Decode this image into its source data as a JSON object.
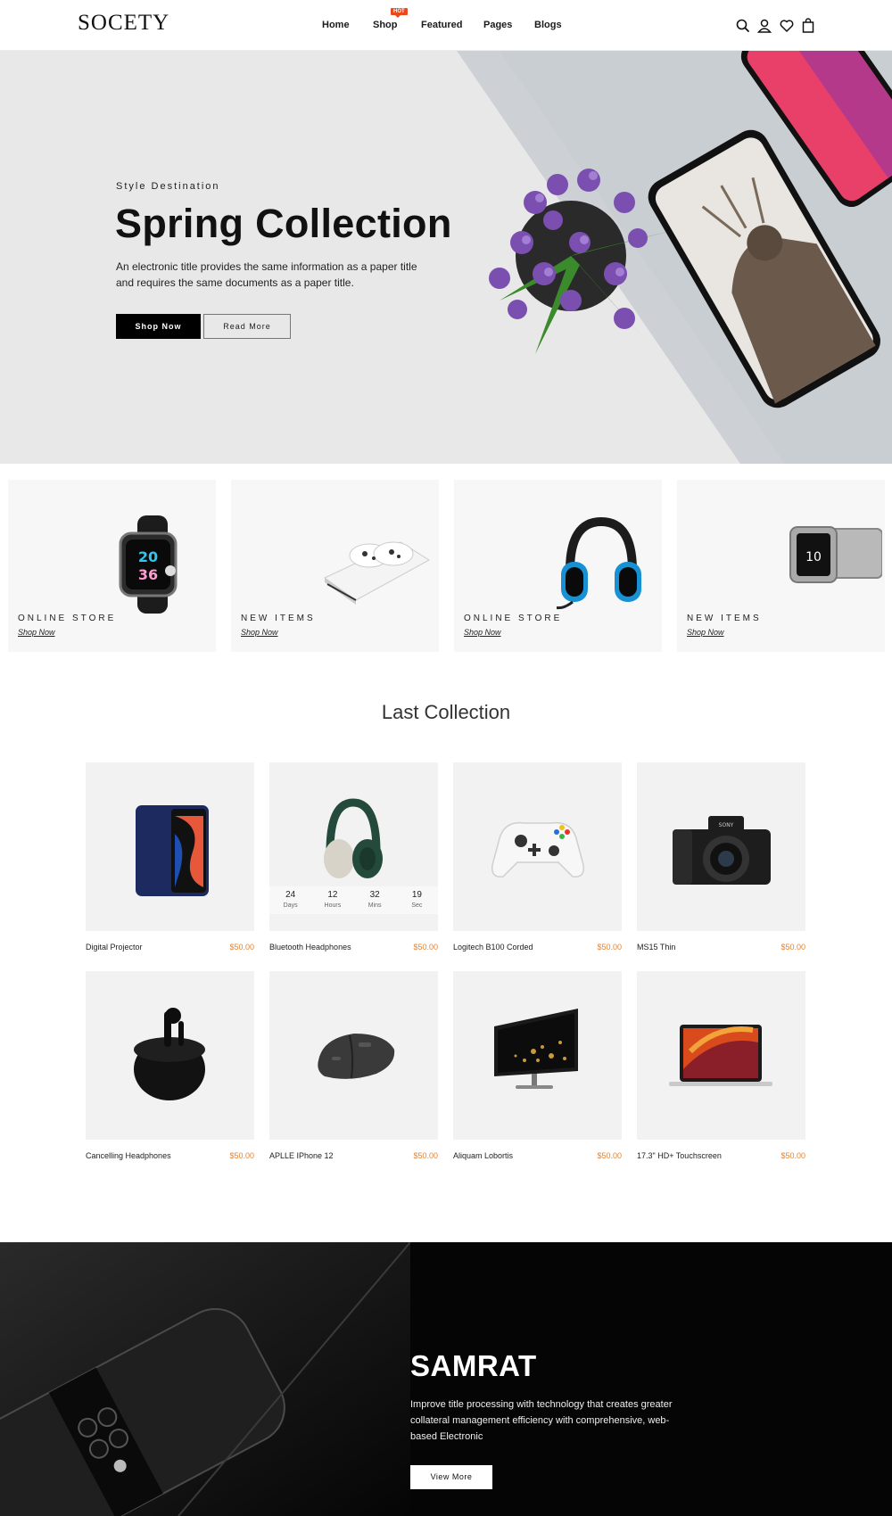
{
  "header": {
    "logo": "SOCETY",
    "nav": [
      {
        "label": "Home"
      },
      {
        "label": "Shop"
      },
      {
        "label": "Featured"
      },
      {
        "label": "Pages"
      },
      {
        "label": "Blogs"
      }
    ],
    "hot_badge": "HOT",
    "icons": [
      "search-icon",
      "user-icon",
      "heart-icon",
      "bag-icon"
    ]
  },
  "hero": {
    "kicker": "Style Destination",
    "title": "Spring Collection",
    "description": "An electronic title provides the same information as a paper title and requires the same documents as a paper title.",
    "primary_button": "Shop Now",
    "secondary_button": "Read More"
  },
  "categories": [
    {
      "label": "ONLINE STORE",
      "link": "Shop Now",
      "product": "smartwatch"
    },
    {
      "label": "NEW ITEMS",
      "link": "Shop Now",
      "product": "game-console"
    },
    {
      "label": "ONLINE STORE",
      "link": "Shop Now",
      "product": "headphones"
    },
    {
      "label": "NEW ITEMS",
      "link": "Shop Now",
      "product": "steel-watch"
    }
  ],
  "collection": {
    "title": "Last Collection",
    "products": [
      {
        "name": "Digital Projector",
        "price": "$50.00",
        "image": "smartphone"
      },
      {
        "name": "Bluetooth Headphones",
        "price": "$50.00",
        "image": "headphones"
      },
      {
        "name": "Logitech B100 Corded",
        "price": "$50.00",
        "image": "game-controller"
      },
      {
        "name": "MS15 Thin",
        "price": "$50.00",
        "image": "camera"
      },
      {
        "name": "Cancelling Headphones",
        "price": "$50.00",
        "image": "earbuds"
      },
      {
        "name": "APLLE IPhone 12",
        "price": "$50.00",
        "image": "mouse"
      },
      {
        "name": "Aliquam Lobortis",
        "price": "$50.00",
        "image": "monitor"
      },
      {
        "name": "17.3\" HD+ Touchscreen",
        "price": "$50.00",
        "image": "laptop"
      }
    ],
    "countdown": [
      {
        "value": "24",
        "label": "Days"
      },
      {
        "value": "12",
        "label": "Hours"
      },
      {
        "value": "32",
        "label": "Mins"
      },
      {
        "value": "19",
        "label": "Sec"
      }
    ]
  },
  "banner": {
    "title": "SAMRAT",
    "description": "Improve title processing with technology that creates greater collateral management efficiency with comprehensive, web-based Electronic",
    "button": "View More"
  },
  "colors": {
    "accent_price": "#e5832f",
    "hot_badge": "#e8491d",
    "hero_bg": "#e8e8e8",
    "banner_bg": "#050505"
  }
}
